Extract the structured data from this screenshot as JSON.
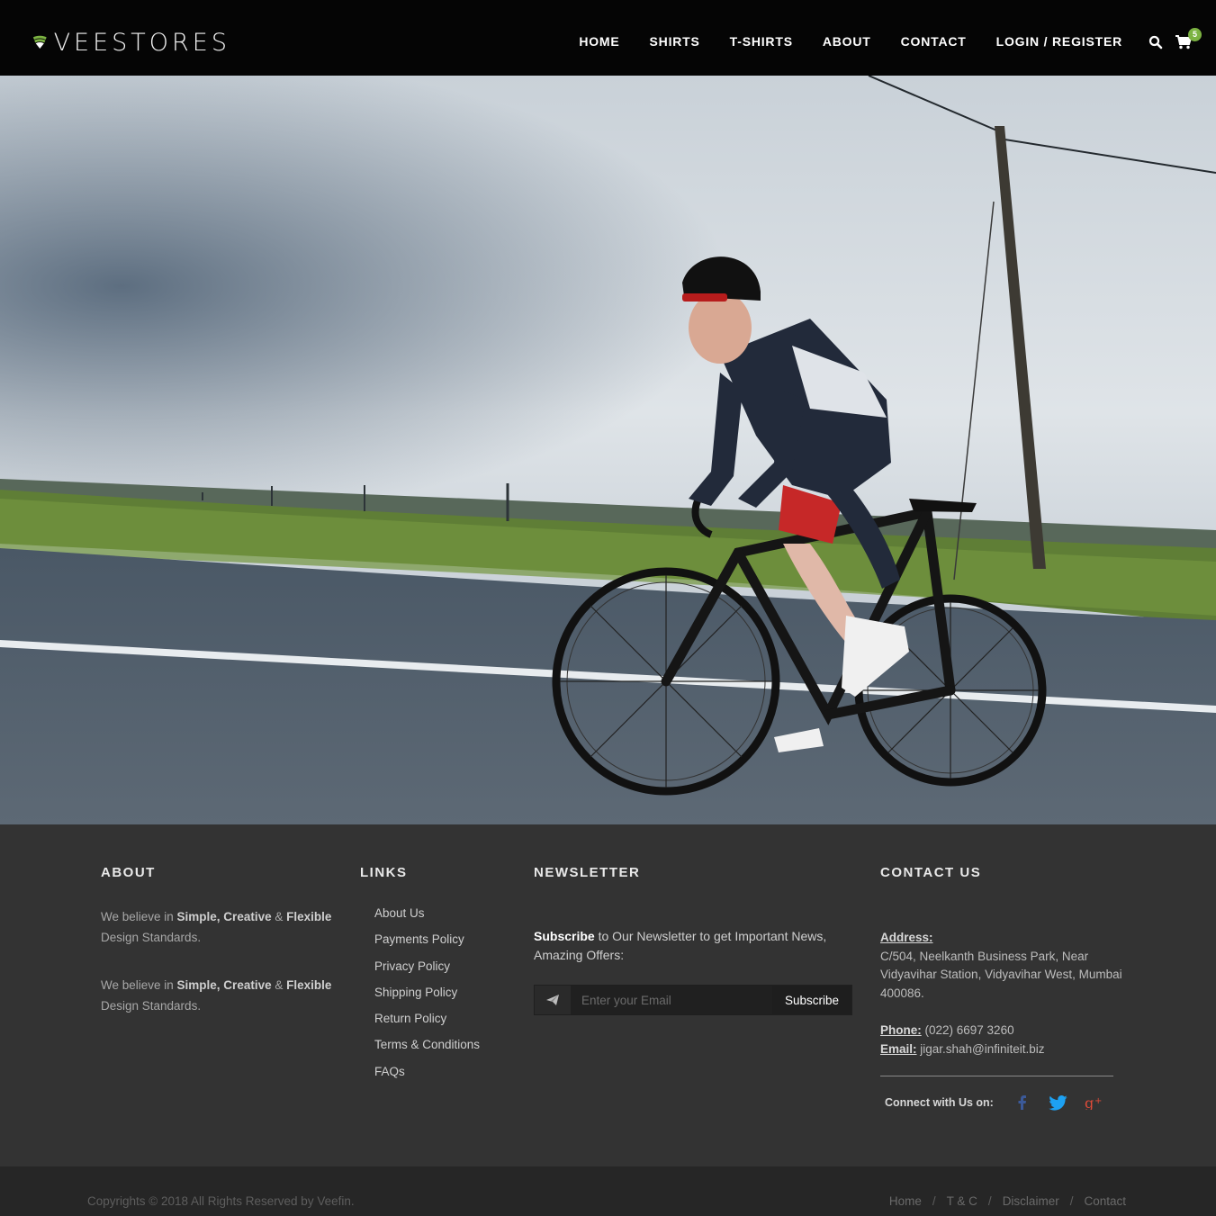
{
  "header": {
    "logo_text": "VEESTORES",
    "nav": [
      "HOME",
      "SHIRTS",
      "T-SHIRTS",
      "ABOUT",
      "CONTACT",
      "LOGIN / REGISTER"
    ],
    "search_icon": "search-icon",
    "cart_icon": "shopping-cart-icon",
    "cart_count": "5",
    "accent_color": "#7cb342"
  },
  "hero": {
    "image": "cyclist-on-road-photo"
  },
  "footer": {
    "about": {
      "title": "ABOUT",
      "paragraphs": [
        {
          "pre": "We believe in ",
          "b1": "Simple, Creative",
          "mid": " & ",
          "b2": "Flexible",
          "post": " Design Standards."
        },
        {
          "pre": "We believe in ",
          "b1": "Simple, Creative",
          "mid": " & ",
          "b2": "Flexible",
          "post": " Design Standards."
        }
      ]
    },
    "links": {
      "title": "LINKS",
      "items": [
        "About Us",
        "Payments Policy",
        "Privacy Policy",
        "Shipping Policy",
        "Return Policy",
        "Terms & Conditions",
        "FAQs"
      ]
    },
    "newsletter": {
      "title": "NEWSLETTER",
      "text_bold": "Subscribe",
      "text_rest": " to Our Newsletter to get Important News, Amazing Offers:",
      "placeholder": "Enter your Email",
      "button": "Subscribe",
      "send_icon": "paper-plane-icon"
    },
    "contact": {
      "title": "CONTACT US",
      "address_label": "Address:",
      "address": "C/504, Neelkanth Business Park, Near Vidyavihar Station, Vidyavihar West, Mumbai 400086.",
      "phone_label": "Phone:",
      "phone": " (022) 6697 3260",
      "email_label": "Email:",
      "email": " jigar.shah@infiniteit.biz",
      "connect_label": "Connect with Us on:",
      "social": [
        {
          "name": "facebook-icon",
          "color": "#3b5998"
        },
        {
          "name": "twitter-icon",
          "color": "#1da1f2"
        },
        {
          "name": "google-plus-icon",
          "color": "#dd4b39"
        }
      ]
    }
  },
  "bottom": {
    "copyright": "Copyrights © 2018 All Rights Reserved by Veefin.",
    "links": [
      "Home",
      "T & C",
      "Disclaimer",
      "Contact"
    ],
    "separator": "/"
  }
}
